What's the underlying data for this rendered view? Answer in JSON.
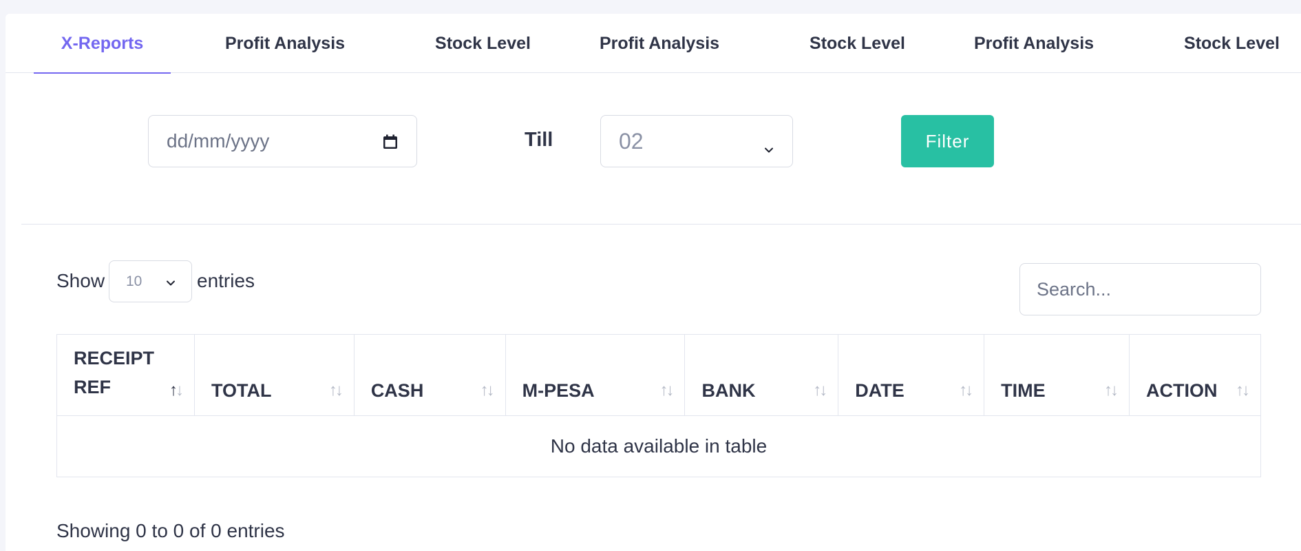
{
  "tabs": [
    {
      "label": "X-Reports",
      "active": true
    },
    {
      "label": "Profit Analysis",
      "active": false
    },
    {
      "label": "Stock Level",
      "active": false
    },
    {
      "label": "Profit Analysis",
      "active": false
    },
    {
      "label": "Stock Level",
      "active": false
    },
    {
      "label": "Profit Analysis",
      "active": false
    },
    {
      "label": "Stock Level",
      "active": false
    }
  ],
  "filter": {
    "date_placeholder": "dd/mm/yyyy",
    "till_label": "Till",
    "till_value": "02",
    "filter_button": "Filter",
    "accent_color": "#28c0a3"
  },
  "table_controls": {
    "show_label": "Show",
    "entries_value": "10",
    "entries_label": "entries",
    "search_placeholder": "Search..."
  },
  "table": {
    "columns": [
      "RECEIPT REF",
      "TOTAL",
      "CASH",
      "M-PESA",
      "BANK",
      "DATE",
      "TIME",
      "ACTION"
    ],
    "empty_message": "No data available in table"
  },
  "footer": {
    "showing": "Showing 0 to 0 of 0 entries"
  },
  "colors": {
    "tab_active": "#7367f0",
    "text": "#2f3447"
  }
}
